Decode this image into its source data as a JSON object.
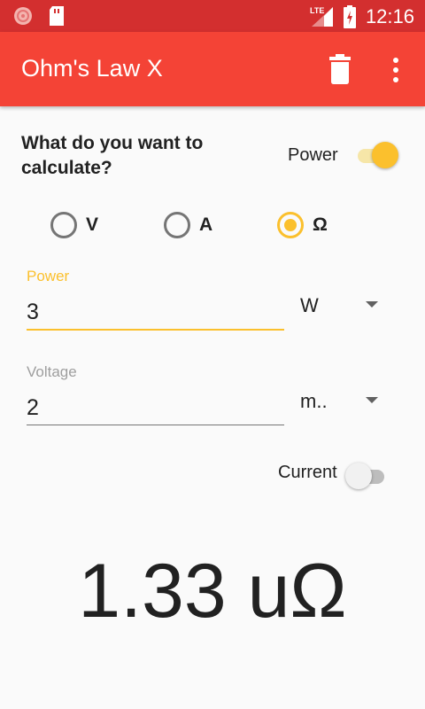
{
  "status_bar": {
    "network": "LTE",
    "time": "12:16",
    "icons": [
      "notification-icon",
      "sd-card-icon",
      "signal-icon",
      "battery-charging-icon"
    ]
  },
  "app_bar": {
    "title": "Ohm's Law X",
    "actions": [
      "trash-icon",
      "more-vert-icon"
    ]
  },
  "calculate": {
    "question": "What do you want to calculate?",
    "power_toggle_label": "Power",
    "power_toggle_on": true,
    "options": [
      {
        "label": "V",
        "checked": false
      },
      {
        "label": "A",
        "checked": false
      },
      {
        "label": "Ω",
        "checked": true
      }
    ]
  },
  "fields": [
    {
      "label": "Power",
      "value": "3",
      "unit": "W",
      "focused": true
    },
    {
      "label": "Voltage",
      "value": "2",
      "unit": "m..",
      "focused": false
    }
  ],
  "current_toggle": {
    "label": "Current",
    "on": false
  },
  "result": "1.33 uΩ",
  "colors": {
    "status_bar": "#d32f2f",
    "app_bar": "#f44336",
    "accent": "#fbc02d",
    "background": "#fafafa"
  }
}
